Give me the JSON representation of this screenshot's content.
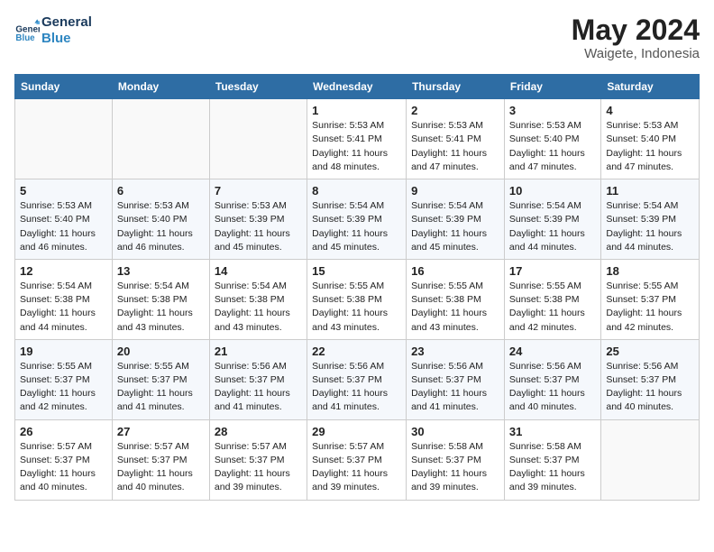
{
  "header": {
    "logo_line1": "General",
    "logo_line2": "Blue",
    "month_year": "May 2024",
    "location": "Waigete, Indonesia"
  },
  "weekdays": [
    "Sunday",
    "Monday",
    "Tuesday",
    "Wednesday",
    "Thursday",
    "Friday",
    "Saturday"
  ],
  "weeks": [
    [
      {
        "day": "",
        "info": ""
      },
      {
        "day": "",
        "info": ""
      },
      {
        "day": "",
        "info": ""
      },
      {
        "day": "1",
        "info": "Sunrise: 5:53 AM\nSunset: 5:41 PM\nDaylight: 11 hours\nand 48 minutes."
      },
      {
        "day": "2",
        "info": "Sunrise: 5:53 AM\nSunset: 5:41 PM\nDaylight: 11 hours\nand 47 minutes."
      },
      {
        "day": "3",
        "info": "Sunrise: 5:53 AM\nSunset: 5:40 PM\nDaylight: 11 hours\nand 47 minutes."
      },
      {
        "day": "4",
        "info": "Sunrise: 5:53 AM\nSunset: 5:40 PM\nDaylight: 11 hours\nand 47 minutes."
      }
    ],
    [
      {
        "day": "5",
        "info": "Sunrise: 5:53 AM\nSunset: 5:40 PM\nDaylight: 11 hours\nand 46 minutes."
      },
      {
        "day": "6",
        "info": "Sunrise: 5:53 AM\nSunset: 5:40 PM\nDaylight: 11 hours\nand 46 minutes."
      },
      {
        "day": "7",
        "info": "Sunrise: 5:53 AM\nSunset: 5:39 PM\nDaylight: 11 hours\nand 45 minutes."
      },
      {
        "day": "8",
        "info": "Sunrise: 5:54 AM\nSunset: 5:39 PM\nDaylight: 11 hours\nand 45 minutes."
      },
      {
        "day": "9",
        "info": "Sunrise: 5:54 AM\nSunset: 5:39 PM\nDaylight: 11 hours\nand 45 minutes."
      },
      {
        "day": "10",
        "info": "Sunrise: 5:54 AM\nSunset: 5:39 PM\nDaylight: 11 hours\nand 44 minutes."
      },
      {
        "day": "11",
        "info": "Sunrise: 5:54 AM\nSunset: 5:39 PM\nDaylight: 11 hours\nand 44 minutes."
      }
    ],
    [
      {
        "day": "12",
        "info": "Sunrise: 5:54 AM\nSunset: 5:38 PM\nDaylight: 11 hours\nand 44 minutes."
      },
      {
        "day": "13",
        "info": "Sunrise: 5:54 AM\nSunset: 5:38 PM\nDaylight: 11 hours\nand 43 minutes."
      },
      {
        "day": "14",
        "info": "Sunrise: 5:54 AM\nSunset: 5:38 PM\nDaylight: 11 hours\nand 43 minutes."
      },
      {
        "day": "15",
        "info": "Sunrise: 5:55 AM\nSunset: 5:38 PM\nDaylight: 11 hours\nand 43 minutes."
      },
      {
        "day": "16",
        "info": "Sunrise: 5:55 AM\nSunset: 5:38 PM\nDaylight: 11 hours\nand 43 minutes."
      },
      {
        "day": "17",
        "info": "Sunrise: 5:55 AM\nSunset: 5:38 PM\nDaylight: 11 hours\nand 42 minutes."
      },
      {
        "day": "18",
        "info": "Sunrise: 5:55 AM\nSunset: 5:37 PM\nDaylight: 11 hours\nand 42 minutes."
      }
    ],
    [
      {
        "day": "19",
        "info": "Sunrise: 5:55 AM\nSunset: 5:37 PM\nDaylight: 11 hours\nand 42 minutes."
      },
      {
        "day": "20",
        "info": "Sunrise: 5:55 AM\nSunset: 5:37 PM\nDaylight: 11 hours\nand 41 minutes."
      },
      {
        "day": "21",
        "info": "Sunrise: 5:56 AM\nSunset: 5:37 PM\nDaylight: 11 hours\nand 41 minutes."
      },
      {
        "day": "22",
        "info": "Sunrise: 5:56 AM\nSunset: 5:37 PM\nDaylight: 11 hours\nand 41 minutes."
      },
      {
        "day": "23",
        "info": "Sunrise: 5:56 AM\nSunset: 5:37 PM\nDaylight: 11 hours\nand 41 minutes."
      },
      {
        "day": "24",
        "info": "Sunrise: 5:56 AM\nSunset: 5:37 PM\nDaylight: 11 hours\nand 40 minutes."
      },
      {
        "day": "25",
        "info": "Sunrise: 5:56 AM\nSunset: 5:37 PM\nDaylight: 11 hours\nand 40 minutes."
      }
    ],
    [
      {
        "day": "26",
        "info": "Sunrise: 5:57 AM\nSunset: 5:37 PM\nDaylight: 11 hours\nand 40 minutes."
      },
      {
        "day": "27",
        "info": "Sunrise: 5:57 AM\nSunset: 5:37 PM\nDaylight: 11 hours\nand 40 minutes."
      },
      {
        "day": "28",
        "info": "Sunrise: 5:57 AM\nSunset: 5:37 PM\nDaylight: 11 hours\nand 39 minutes."
      },
      {
        "day": "29",
        "info": "Sunrise: 5:57 AM\nSunset: 5:37 PM\nDaylight: 11 hours\nand 39 minutes."
      },
      {
        "day": "30",
        "info": "Sunrise: 5:58 AM\nSunset: 5:37 PM\nDaylight: 11 hours\nand 39 minutes."
      },
      {
        "day": "31",
        "info": "Sunrise: 5:58 AM\nSunset: 5:37 PM\nDaylight: 11 hours\nand 39 minutes."
      },
      {
        "day": "",
        "info": ""
      }
    ]
  ]
}
